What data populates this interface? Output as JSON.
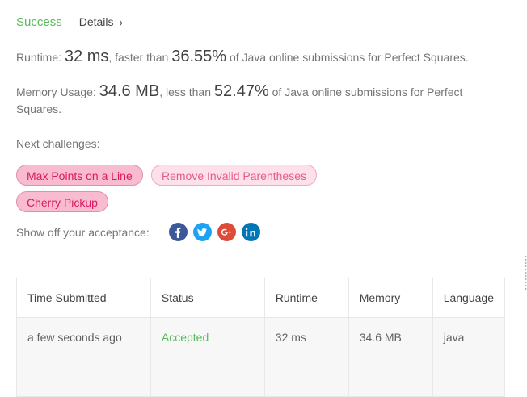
{
  "header": {
    "status": "Success",
    "details_label": "Details",
    "details_chevron": "›"
  },
  "runtime_stat": {
    "label": "Runtime:",
    "value": "32 ms",
    "faster_than": ", faster than",
    "percent": "36.55%",
    "suffix": "of Java online submissions for Perfect Squares."
  },
  "memory_stat": {
    "label": "Memory Usage:",
    "value": "34.6 MB",
    "less_than": ", less than",
    "percent": "52.47%",
    "suffix": "of Java online submissions for Perfect Squares."
  },
  "next_challenges": {
    "label": "Next challenges:",
    "items": [
      {
        "title": "Max Points on a Line",
        "difficulty_color": "#f8bbd0"
      },
      {
        "title": "Remove Invalid Parentheses",
        "difficulty_color": "#fde0ea"
      },
      {
        "title": "Cherry Pickup",
        "difficulty_color": "#f8bbd0"
      }
    ]
  },
  "share": {
    "label": "Show off your acceptance:",
    "icons": [
      "facebook-icon",
      "twitter-icon",
      "google-plus-icon",
      "linkedin-icon"
    ]
  },
  "submissions": {
    "headers": [
      "Time Submitted",
      "Status",
      "Runtime",
      "Memory",
      "Language"
    ],
    "rows": [
      {
        "time": "a few seconds ago",
        "status": "Accepted",
        "runtime": "32 ms",
        "memory": "34.6 MB",
        "language": "java"
      }
    ]
  },
  "colors": {
    "success": "#5cb85c",
    "tag_medium_bg": "#f8bbd0",
    "tag_text": "#d81b60"
  }
}
